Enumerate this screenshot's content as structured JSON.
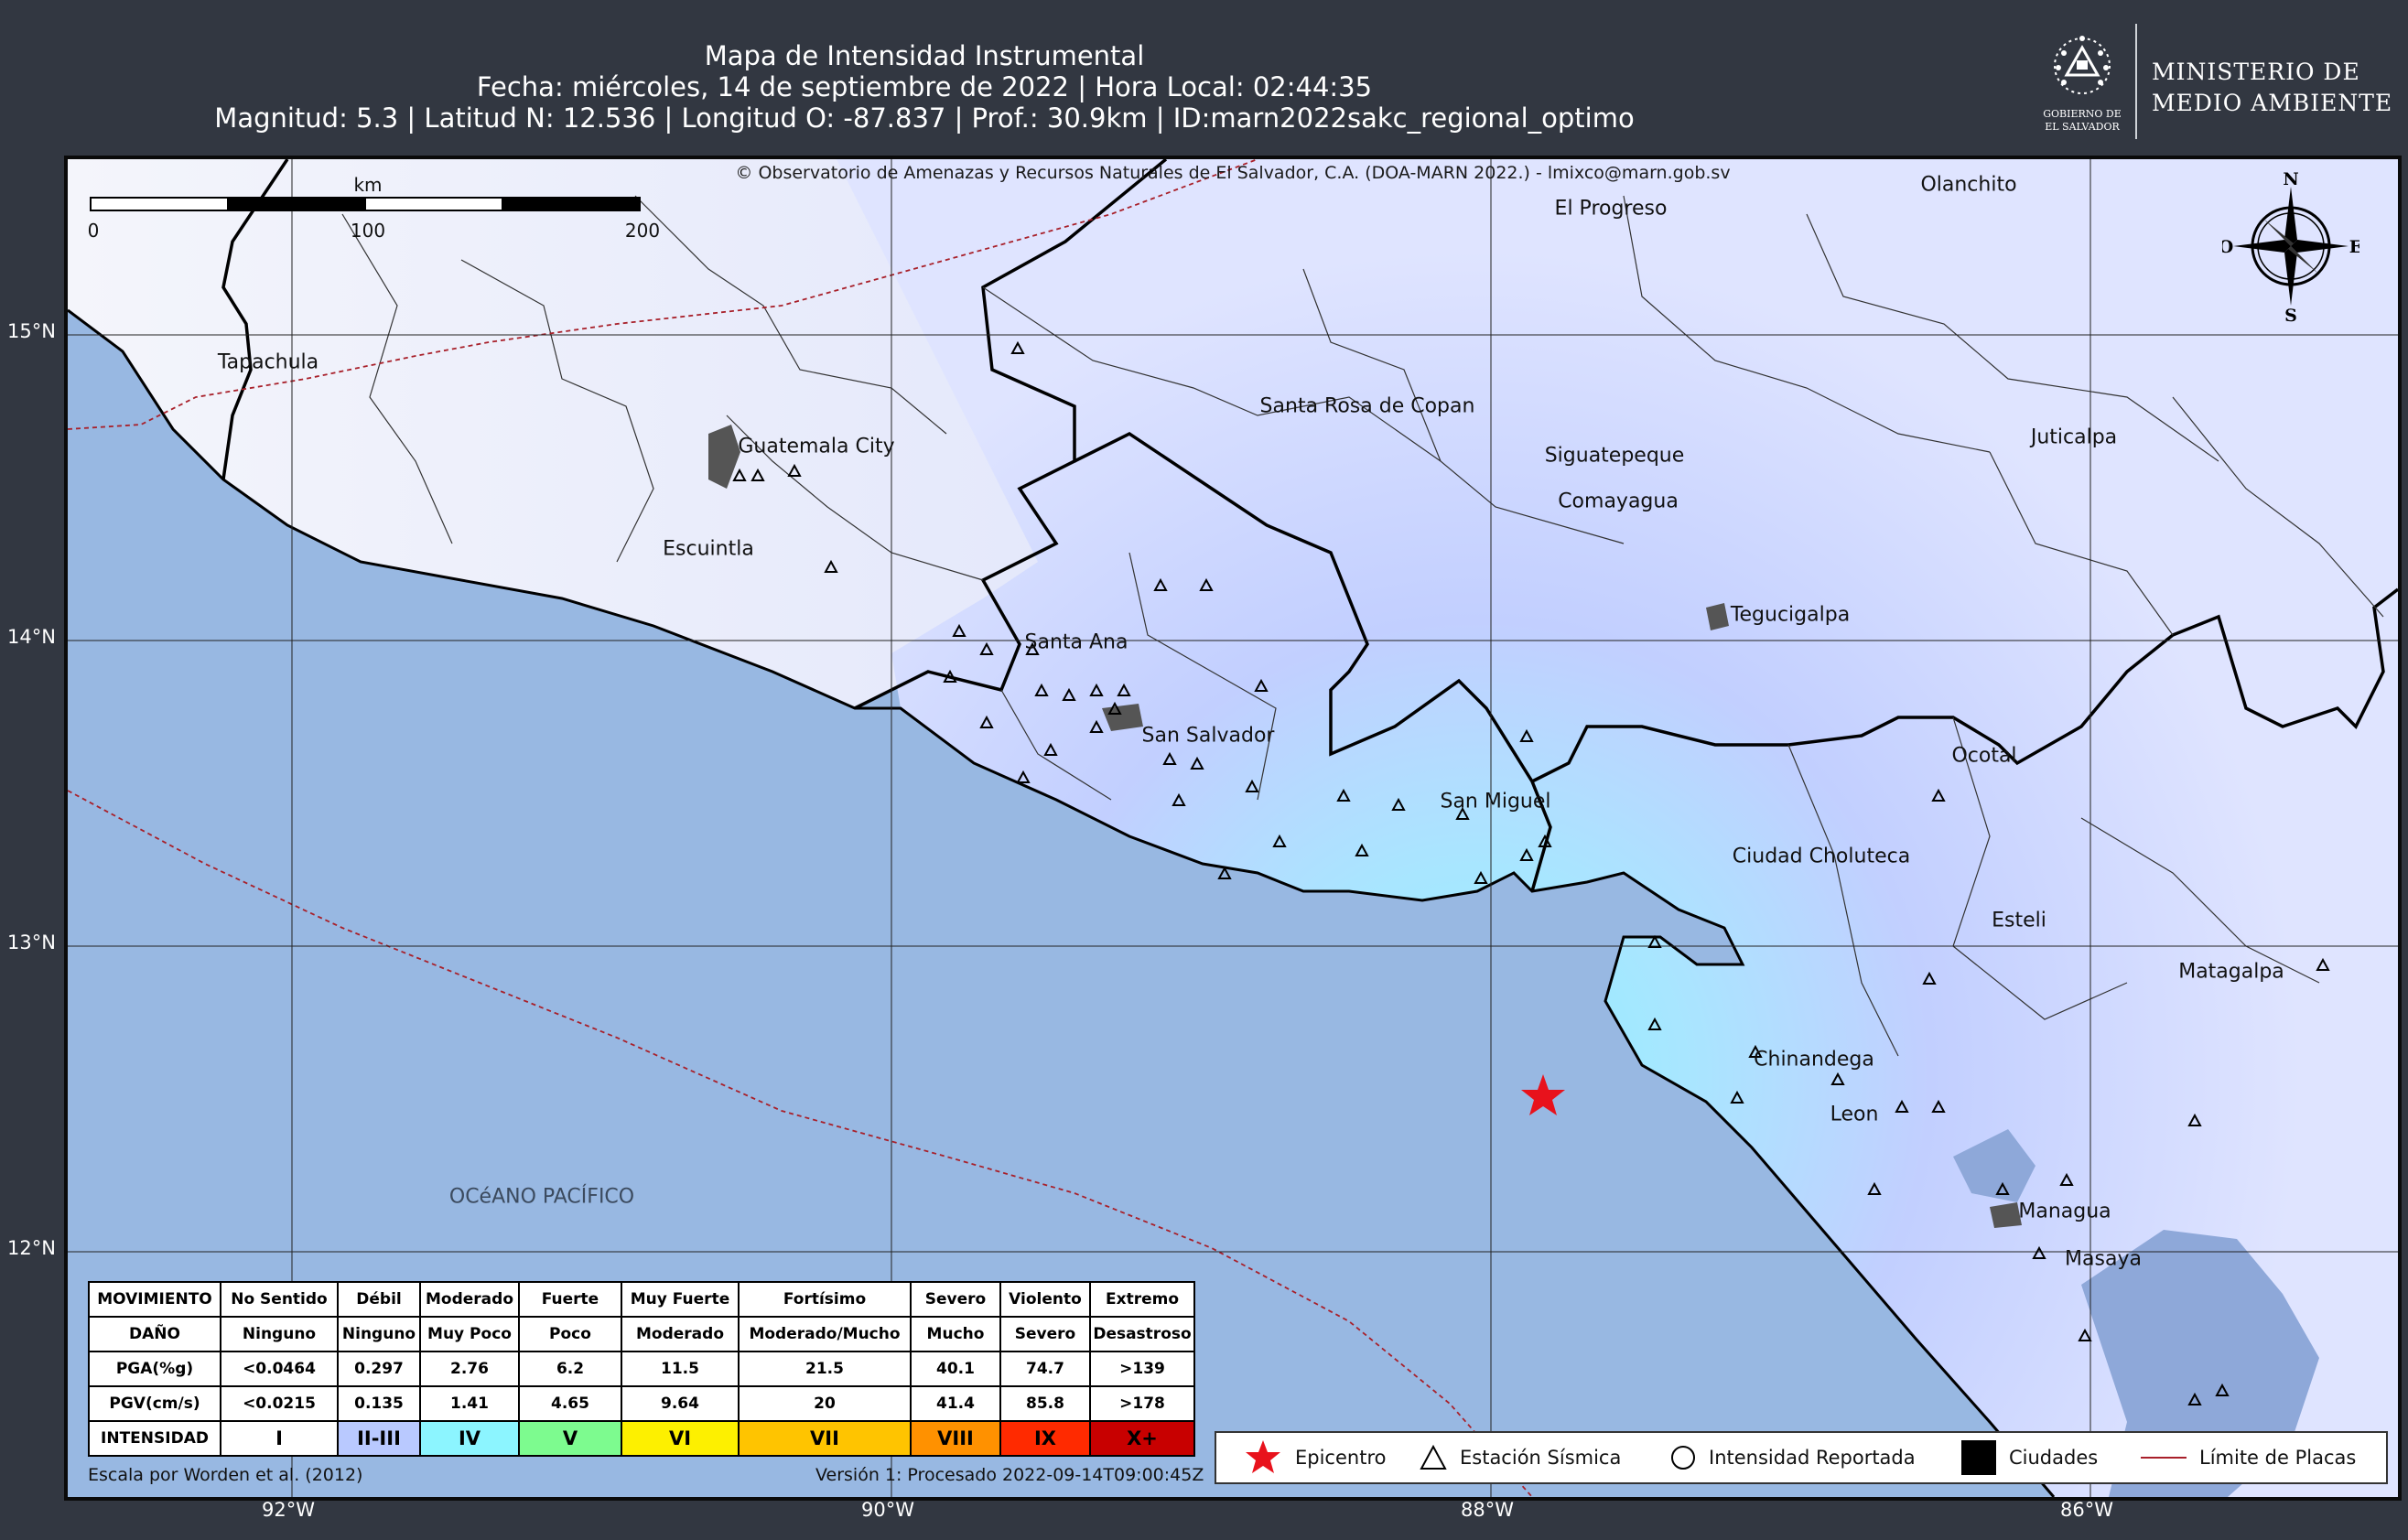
{
  "header": {
    "title": "Mapa de Intensidad Instrumental",
    "date_line": "Fecha: miércoles, 14 de septiembre de 2022 | Hora Local: 02:44:35",
    "params_line": "Magnitud: 5.3 | Latitud N: 12.536 | Longitud O: -87.837 | Prof.: 30.9km | ID:marn2022sakc_regional_optimo"
  },
  "logo": {
    "seal_text": "GOBIERNO DE EL SALVADOR",
    "name_line1": "MINISTERIO DE",
    "name_line2": "MEDIO AMBIENTE",
    "seal_icon": "coat-of-arms-seal-icon"
  },
  "map": {
    "copyright": "© Observatorio de Amenazas y Recursos Naturales de El Salvador, C.A. (DOA-MARN 2022.) - lmixco@marn.gob.sv",
    "ocean_label": "OCéANO PACÍFICO",
    "scale": {
      "unit": "km",
      "ticks": [
        "0",
        "100",
        "200"
      ]
    },
    "cities": [
      "El Progreso",
      "Olanchito",
      "Tapachula",
      "Santa Rosa de Copan",
      "Guatemala City",
      "Siguatepeque",
      "Juticalpa",
      "Comayagua",
      "Escuintla",
      "Tegucigalpa",
      "Santa Ana",
      "San Salvador",
      "Ocotal",
      "San Miguel",
      "Ciudad Choluteca",
      "Esteli",
      "Matagalpa",
      "Chinandega",
      "Leon",
      "Managua",
      "Masaya"
    ],
    "lat_labels": [
      "15°N",
      "14°N",
      "13°N",
      "12°N"
    ],
    "lon_labels": [
      "92°W",
      "90°W",
      "88°W",
      "86°W"
    ],
    "epicenter": {
      "lat": 12.536,
      "lon": -87.837,
      "color": "#e8121c"
    },
    "compass": {
      "n": "N",
      "s": "S",
      "e": "E",
      "o": "O"
    }
  },
  "intensity_table": {
    "headers": {
      "movimiento": "MOVIMIENTO",
      "dano": "DAÑO",
      "pga": "PGA(%g)",
      "pgv": "PGV(cm/s)",
      "intensidad": "INTENSIDAD"
    },
    "columns": [
      {
        "mov": "No Sentido",
        "dano": "Ninguno",
        "pga": "<0.0464",
        "pgv": "<0.0215",
        "int": "I",
        "color": "#ffffff"
      },
      {
        "mov": "Débil",
        "dano": "Ninguno",
        "pga": "0.297",
        "pgv": "0.135",
        "int": "II-III",
        "color": "#b9c9ff"
      },
      {
        "mov": "Moderado",
        "dano": "Muy Poco",
        "pga": "2.76",
        "pgv": "1.41",
        "int": "IV",
        "color": "#8cf5ff"
      },
      {
        "mov": "Fuerte",
        "dano": "Poco",
        "pga": "6.2",
        "pgv": "4.65",
        "int": "V",
        "color": "#7dfb8f"
      },
      {
        "mov": "Muy Fuerte",
        "dano": "Moderado",
        "pga": "11.5",
        "pgv": "9.64",
        "int": "VI",
        "color": "#fdf000"
      },
      {
        "mov": "Fortísimo",
        "dano": "Moderado/Mucho",
        "pga": "21.5",
        "pgv": "20",
        "int": "VII",
        "color": "#ffc400"
      },
      {
        "mov": "Severo",
        "dano": "Mucho",
        "pga": "40.1",
        "pgv": "41.4",
        "int": "VIII",
        "color": "#ff9100"
      },
      {
        "mov": "Violento",
        "dano": "Severo",
        "pga": "74.7",
        "pgv": "85.8",
        "int": "IX",
        "color": "#ff2a00"
      },
      {
        "mov": "Extremo",
        "dano": "Desastroso",
        "pga": ">139",
        "pgv": ">178",
        "int": "X+",
        "color": "#c80000"
      }
    ]
  },
  "credits": {
    "left": "Escala por Worden et al. (2012)",
    "right": "Versión 1: Procesado 2022-09-14T09:00:45Z"
  },
  "symbol_legend": {
    "epicentro": "Epicentro",
    "estacion": "Estación Sísmica",
    "intensidad": "Intensidad Reportada",
    "ciudades": "Ciudades",
    "placas": "Límite de Placas"
  }
}
